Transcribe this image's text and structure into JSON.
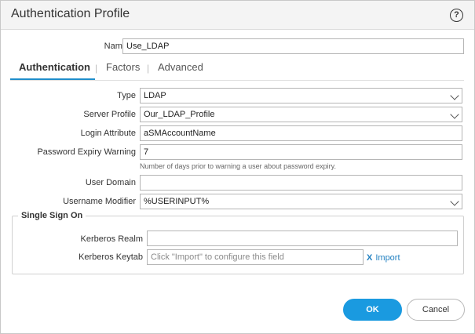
{
  "dialog": {
    "title": "Authentication Profile",
    "help_icon": "?"
  },
  "name_field": {
    "label": "Name",
    "value": "Use_LDAP"
  },
  "tabs": [
    {
      "label": "Authentication",
      "active": true
    },
    {
      "label": "Factors",
      "active": false
    },
    {
      "label": "Advanced",
      "active": false
    }
  ],
  "tab_separator": "|",
  "form": {
    "type": {
      "label": "Type",
      "value": "LDAP"
    },
    "server_profile": {
      "label": "Server Profile",
      "value": "Our_LDAP_Profile"
    },
    "login_attribute": {
      "label": "Login Attribute",
      "value": "aSMAccountName"
    },
    "password_expiry": {
      "label": "Password Expiry Warning",
      "value": "7",
      "help": "Number of days prior to warning a user about password expiry."
    },
    "user_domain": {
      "label": "User Domain",
      "value": ""
    },
    "username_modifier": {
      "label": "Username Modifier",
      "value": "%USERINPUT%"
    }
  },
  "sso": {
    "legend": "Single Sign On",
    "kerberos_realm": {
      "label": "Kerberos Realm",
      "value": ""
    },
    "kerberos_keytab": {
      "label": "Kerberos Keytab",
      "placeholder": "Click \"Import\" to configure this field"
    },
    "import_label": "Import",
    "import_icon": "X"
  },
  "buttons": {
    "ok": "OK",
    "cancel": "Cancel"
  },
  "colors": {
    "accent": "#1a9ae0",
    "link": "#1f7fc0"
  }
}
